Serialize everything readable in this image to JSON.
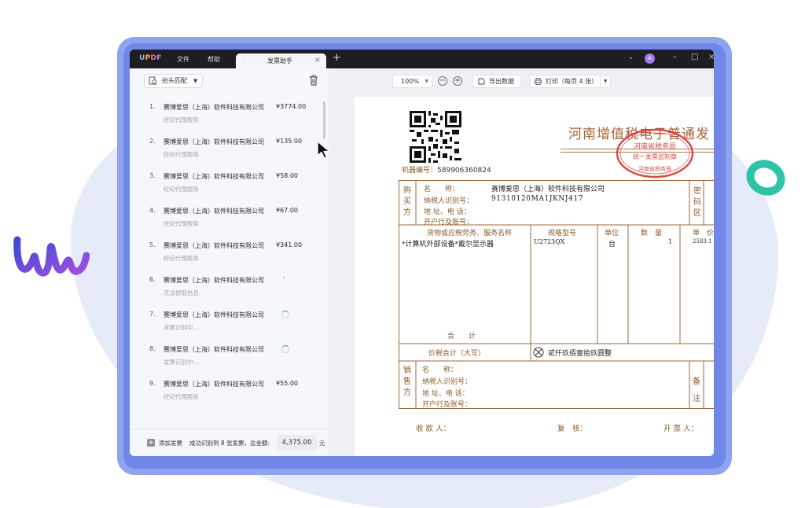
{
  "app": {
    "logo": "UPDF",
    "menus": [
      "文件",
      "帮助"
    ],
    "tab_label": "发票助手",
    "avatar_letter": "A"
  },
  "sidebar": {
    "match_label": "抬头匹配",
    "items": [
      {
        "num": "1.",
        "company": "赛博爱思（上海）软件科技有限公司",
        "amount": "¥3774.00",
        "sub": "经纪代理服务",
        "state": "done"
      },
      {
        "num": "2.",
        "company": "赛博爱思（上海）软件科技有限公司",
        "amount": "¥135.00",
        "sub": "经纪代理服务",
        "state": "done"
      },
      {
        "num": "3.",
        "company": "赛博爱思（上海）软件科技有限公司",
        "amount": "¥58.00",
        "sub": "经纪代理服务",
        "state": "done"
      },
      {
        "num": "4.",
        "company": "赛博爱思（上海）软件科技有限公司",
        "amount": "¥67.00",
        "sub": "经纪代理服务",
        "state": "done"
      },
      {
        "num": "5.",
        "company": "赛博爱思（上海）软件科技有限公司",
        "amount": "¥341.00",
        "sub": "经纪代理服务",
        "state": "done"
      },
      {
        "num": "6.",
        "company": "赛博爱思（上海）软件科技有限公司",
        "amount": "",
        "sub": "无法提取信息",
        "state": "error"
      },
      {
        "num": "7.",
        "company": "赛博爱思（上海）软件科技有限公司",
        "amount": "",
        "sub": "发票识别中...",
        "state": "loading"
      },
      {
        "num": "8.",
        "company": "赛博爱思（上海）软件科技有限公司",
        "amount": "",
        "sub": "发票识别中...",
        "state": "loading"
      },
      {
        "num": "9.",
        "company": "赛博爱思（上海）软件科技有限公司",
        "amount": "¥55.00",
        "sub": "经纪代理服务",
        "state": "done"
      }
    ],
    "footer": {
      "add_label": "添加发票",
      "summary": "成功识别到 8 张发票，总金额:",
      "total": "4,375.00",
      "unit": "元"
    }
  },
  "toolbar": {
    "zoom": "100%",
    "export_label": "导出数据",
    "print_label": "打印（每页 4 张）"
  },
  "invoice": {
    "title": "河南增值税电子普通发",
    "machine_label": "机器编号：",
    "machine_no": "589906360824",
    "buyer_label": "购买方",
    "buyer_fields": [
      "名　　称：",
      "纳税人识别号：",
      "地 址、电 话：",
      "开户行及账号："
    ],
    "buyer_name": "赛博爱思（上海）软件科技有限公司",
    "buyer_tax_id": "91310120MA1JKNJ417",
    "password_label": "密码区",
    "col_goods": "货物或应税劳务、服务名称",
    "col_spec": "规格型号",
    "col_unit": "单位",
    "col_qty": "数　量",
    "col_price": "单　价",
    "item_name": "*计算机外部设备*戴尔显示器",
    "item_spec": "U2723QX",
    "item_unit": "台",
    "item_qty": "1",
    "item_price": "2583.1",
    "sum_label": "合　　计",
    "total_label": "价税合计（大写）",
    "total_words": "贰仟玖佰壹拾玖圆整",
    "seller_label": "销售方",
    "seller_fields": [
      "名　　称：",
      "纳税人识别号：",
      "地 址、电 话：",
      "开户行及账号："
    ],
    "remark_label": "备注",
    "payee_label": "收 款 人：",
    "reviewer_label": "复　核：",
    "drawer_label": "开 票 人：",
    "stamp_text_top": "河南省税务局",
    "stamp_text_mid": "统一发票监制章",
    "stamp_text_bottom": "河南省税务局"
  },
  "colors": {
    "frame": "#8ea4ee",
    "accent": "#5a6ee0",
    "invoice_brown": "#8a5a2b",
    "stamp_red": "#d23a3a"
  }
}
